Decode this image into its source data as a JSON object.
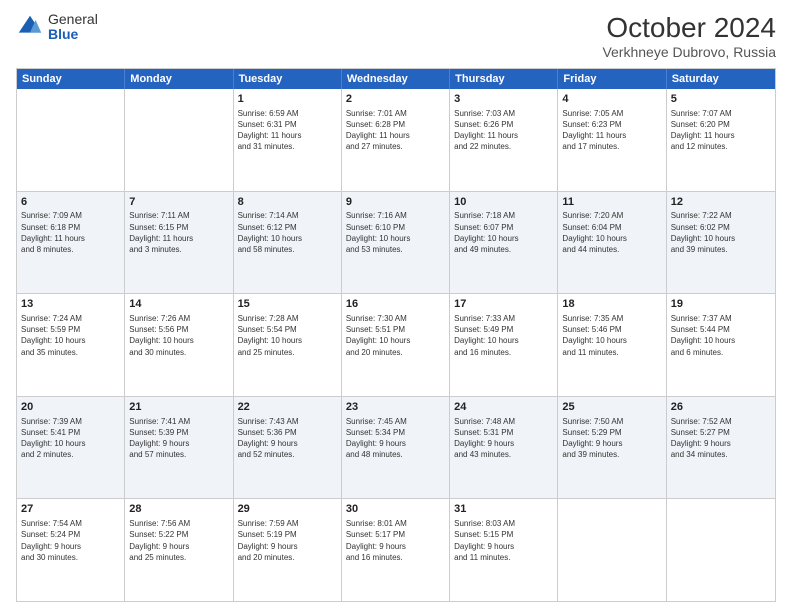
{
  "header": {
    "logo_general": "General",
    "logo_blue": "Blue",
    "month_title": "October 2024",
    "location": "Verkhneye Dubrovo, Russia"
  },
  "days": [
    "Sunday",
    "Monday",
    "Tuesday",
    "Wednesday",
    "Thursday",
    "Friday",
    "Saturday"
  ],
  "rows": [
    [
      {
        "day": "",
        "lines": []
      },
      {
        "day": "",
        "lines": []
      },
      {
        "day": "1",
        "lines": [
          "Sunrise: 6:59 AM",
          "Sunset: 6:31 PM",
          "Daylight: 11 hours",
          "and 31 minutes."
        ]
      },
      {
        "day": "2",
        "lines": [
          "Sunrise: 7:01 AM",
          "Sunset: 6:28 PM",
          "Daylight: 11 hours",
          "and 27 minutes."
        ]
      },
      {
        "day": "3",
        "lines": [
          "Sunrise: 7:03 AM",
          "Sunset: 6:26 PM",
          "Daylight: 11 hours",
          "and 22 minutes."
        ]
      },
      {
        "day": "4",
        "lines": [
          "Sunrise: 7:05 AM",
          "Sunset: 6:23 PM",
          "Daylight: 11 hours",
          "and 17 minutes."
        ]
      },
      {
        "day": "5",
        "lines": [
          "Sunrise: 7:07 AM",
          "Sunset: 6:20 PM",
          "Daylight: 11 hours",
          "and 12 minutes."
        ]
      }
    ],
    [
      {
        "day": "6",
        "lines": [
          "Sunrise: 7:09 AM",
          "Sunset: 6:18 PM",
          "Daylight: 11 hours",
          "and 8 minutes."
        ]
      },
      {
        "day": "7",
        "lines": [
          "Sunrise: 7:11 AM",
          "Sunset: 6:15 PM",
          "Daylight: 11 hours",
          "and 3 minutes."
        ]
      },
      {
        "day": "8",
        "lines": [
          "Sunrise: 7:14 AM",
          "Sunset: 6:12 PM",
          "Daylight: 10 hours",
          "and 58 minutes."
        ]
      },
      {
        "day": "9",
        "lines": [
          "Sunrise: 7:16 AM",
          "Sunset: 6:10 PM",
          "Daylight: 10 hours",
          "and 53 minutes."
        ]
      },
      {
        "day": "10",
        "lines": [
          "Sunrise: 7:18 AM",
          "Sunset: 6:07 PM",
          "Daylight: 10 hours",
          "and 49 minutes."
        ]
      },
      {
        "day": "11",
        "lines": [
          "Sunrise: 7:20 AM",
          "Sunset: 6:04 PM",
          "Daylight: 10 hours",
          "and 44 minutes."
        ]
      },
      {
        "day": "12",
        "lines": [
          "Sunrise: 7:22 AM",
          "Sunset: 6:02 PM",
          "Daylight: 10 hours",
          "and 39 minutes."
        ]
      }
    ],
    [
      {
        "day": "13",
        "lines": [
          "Sunrise: 7:24 AM",
          "Sunset: 5:59 PM",
          "Daylight: 10 hours",
          "and 35 minutes."
        ]
      },
      {
        "day": "14",
        "lines": [
          "Sunrise: 7:26 AM",
          "Sunset: 5:56 PM",
          "Daylight: 10 hours",
          "and 30 minutes."
        ]
      },
      {
        "day": "15",
        "lines": [
          "Sunrise: 7:28 AM",
          "Sunset: 5:54 PM",
          "Daylight: 10 hours",
          "and 25 minutes."
        ]
      },
      {
        "day": "16",
        "lines": [
          "Sunrise: 7:30 AM",
          "Sunset: 5:51 PM",
          "Daylight: 10 hours",
          "and 20 minutes."
        ]
      },
      {
        "day": "17",
        "lines": [
          "Sunrise: 7:33 AM",
          "Sunset: 5:49 PM",
          "Daylight: 10 hours",
          "and 16 minutes."
        ]
      },
      {
        "day": "18",
        "lines": [
          "Sunrise: 7:35 AM",
          "Sunset: 5:46 PM",
          "Daylight: 10 hours",
          "and 11 minutes."
        ]
      },
      {
        "day": "19",
        "lines": [
          "Sunrise: 7:37 AM",
          "Sunset: 5:44 PM",
          "Daylight: 10 hours",
          "and 6 minutes."
        ]
      }
    ],
    [
      {
        "day": "20",
        "lines": [
          "Sunrise: 7:39 AM",
          "Sunset: 5:41 PM",
          "Daylight: 10 hours",
          "and 2 minutes."
        ]
      },
      {
        "day": "21",
        "lines": [
          "Sunrise: 7:41 AM",
          "Sunset: 5:39 PM",
          "Daylight: 9 hours",
          "and 57 minutes."
        ]
      },
      {
        "day": "22",
        "lines": [
          "Sunrise: 7:43 AM",
          "Sunset: 5:36 PM",
          "Daylight: 9 hours",
          "and 52 minutes."
        ]
      },
      {
        "day": "23",
        "lines": [
          "Sunrise: 7:45 AM",
          "Sunset: 5:34 PM",
          "Daylight: 9 hours",
          "and 48 minutes."
        ]
      },
      {
        "day": "24",
        "lines": [
          "Sunrise: 7:48 AM",
          "Sunset: 5:31 PM",
          "Daylight: 9 hours",
          "and 43 minutes."
        ]
      },
      {
        "day": "25",
        "lines": [
          "Sunrise: 7:50 AM",
          "Sunset: 5:29 PM",
          "Daylight: 9 hours",
          "and 39 minutes."
        ]
      },
      {
        "day": "26",
        "lines": [
          "Sunrise: 7:52 AM",
          "Sunset: 5:27 PM",
          "Daylight: 9 hours",
          "and 34 minutes."
        ]
      }
    ],
    [
      {
        "day": "27",
        "lines": [
          "Sunrise: 7:54 AM",
          "Sunset: 5:24 PM",
          "Daylight: 9 hours",
          "and 30 minutes."
        ]
      },
      {
        "day": "28",
        "lines": [
          "Sunrise: 7:56 AM",
          "Sunset: 5:22 PM",
          "Daylight: 9 hours",
          "and 25 minutes."
        ]
      },
      {
        "day": "29",
        "lines": [
          "Sunrise: 7:59 AM",
          "Sunset: 5:19 PM",
          "Daylight: 9 hours",
          "and 20 minutes."
        ]
      },
      {
        "day": "30",
        "lines": [
          "Sunrise: 8:01 AM",
          "Sunset: 5:17 PM",
          "Daylight: 9 hours",
          "and 16 minutes."
        ]
      },
      {
        "day": "31",
        "lines": [
          "Sunrise: 8:03 AM",
          "Sunset: 5:15 PM",
          "Daylight: 9 hours",
          "and 11 minutes."
        ]
      },
      {
        "day": "",
        "lines": []
      },
      {
        "day": "",
        "lines": []
      }
    ]
  ]
}
